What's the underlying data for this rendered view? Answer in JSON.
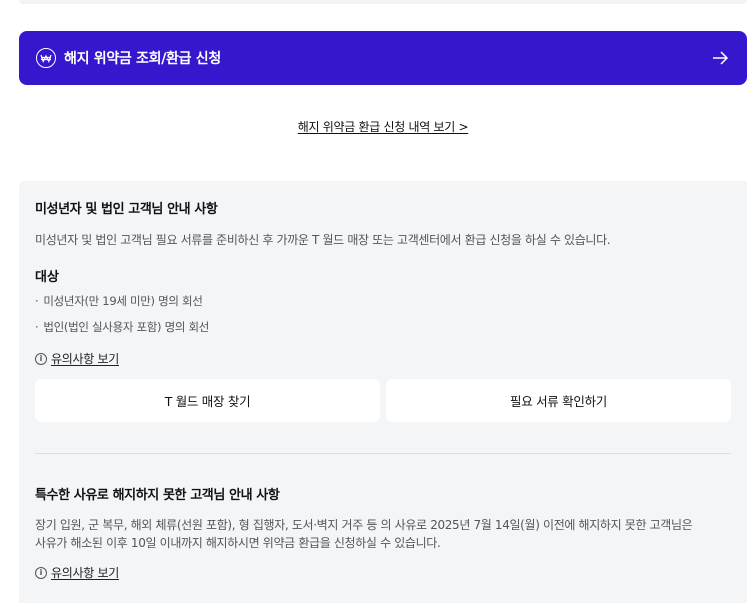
{
  "cta": {
    "label": "해지 위약금 조회/환급 신청",
    "icon": "won-icon",
    "arrow": "arrow-right-icon",
    "color": "#3617ce"
  },
  "history_link": "해지 위약금 환급 신청 내역 보기 >",
  "section1": {
    "title": "미성년자 및 법인 고객님 안내 사항",
    "desc": "미성년자 및 법인 고객님 필요 서류를 준비하신 후 가까운 T 월드 매장 또는 고객센터에서 환급 신청을 하실 수 있습니다.",
    "target_title": "대상",
    "targets": [
      "미성년자(만 19세 미만) 명의 회선",
      "법인(법인 실사용자 포함) 명의 회선"
    ],
    "notice_label": "유의사항 보기",
    "buttons": {
      "store": "T 월드 매장 찾기",
      "docs": "필요 서류 확인하기"
    }
  },
  "section2": {
    "title": "특수한 사유로 해지하지 못한 고객님 안내 사항",
    "desc_line1": "장기 입원, 군 복무, 해외 체류(선원 포함), 형 집행자, 도서·벽지 거주 등 의 사유로 2025년 7월 14일(월) 이전에 해지하지 못한 고객님은",
    "desc_line2": "사유가 해소된 이후 10일 이내까지 해지하시면 위약금 환급을 신청하실 수 있습니다.",
    "notice_label": "유의사항 보기"
  }
}
